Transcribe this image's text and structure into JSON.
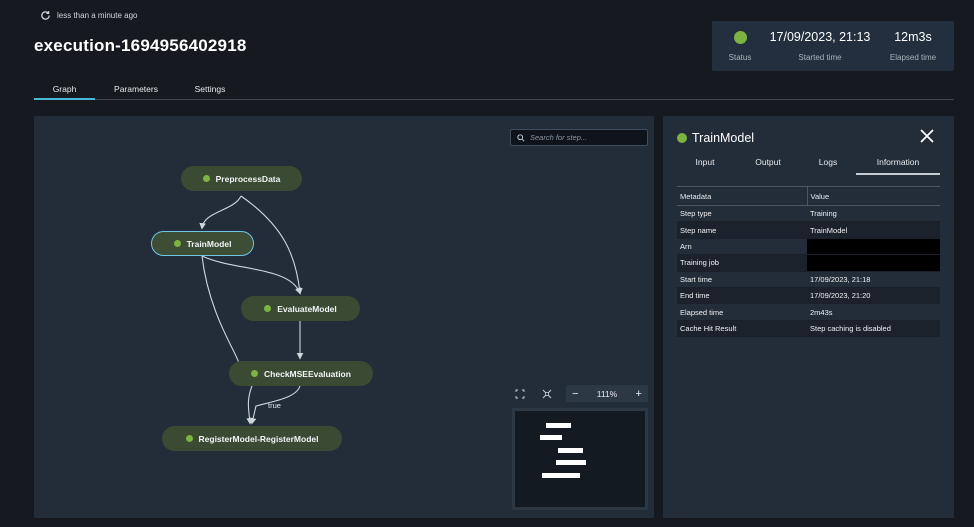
{
  "header": {
    "refresh_label": "less than a minute ago",
    "title": "execution-1694956402918"
  },
  "status_card": {
    "status_label": "Status",
    "status_color": "#7cb342",
    "started_time": "17/09/2023, 21:13",
    "started_label": "Started time",
    "elapsed_time": "12m3s",
    "elapsed_label": "Elapsed time"
  },
  "tabs": [
    {
      "label": "Graph",
      "active": true
    },
    {
      "label": "Parameters",
      "active": false
    },
    {
      "label": "Settings",
      "active": false
    }
  ],
  "graph": {
    "search_placeholder": "Search for step...",
    "nodes": [
      {
        "id": "preprocess",
        "label": "PreprocessData"
      },
      {
        "id": "train",
        "label": "TrainModel",
        "selected": true
      },
      {
        "id": "evaluate",
        "label": "EvaluateModel"
      },
      {
        "id": "check",
        "label": "CheckMSEEvaluation"
      },
      {
        "id": "register",
        "label": "RegisterModel-RegisterModel"
      }
    ],
    "edge_label_true": "true",
    "zoom_level": "111%",
    "zoom_minus": "−",
    "zoom_plus": "+"
  },
  "info_panel": {
    "title": "TrainModel",
    "tabs": [
      {
        "label": "Input",
        "active": false
      },
      {
        "label": "Output",
        "active": false
      },
      {
        "label": "Logs",
        "active": false
      },
      {
        "label": "Information",
        "active": true
      }
    ],
    "table": {
      "headers": [
        "Metadata",
        "Value"
      ],
      "rows": [
        {
          "key": "Step type",
          "value": "Training"
        },
        {
          "key": "Step name",
          "value": "TrainModel"
        },
        {
          "key": "Arn",
          "value": "",
          "redacted": true
        },
        {
          "key": "Training job",
          "value": "",
          "redacted": true
        },
        {
          "key": "Start time",
          "value": "17/09/2023, 21:18"
        },
        {
          "key": "End time",
          "value": "17/09/2023, 21:20"
        },
        {
          "key": "Elapsed time",
          "value": "2m43s"
        },
        {
          "key": "Cache Hit Result",
          "value": "Step caching is disabled"
        }
      ]
    }
  }
}
